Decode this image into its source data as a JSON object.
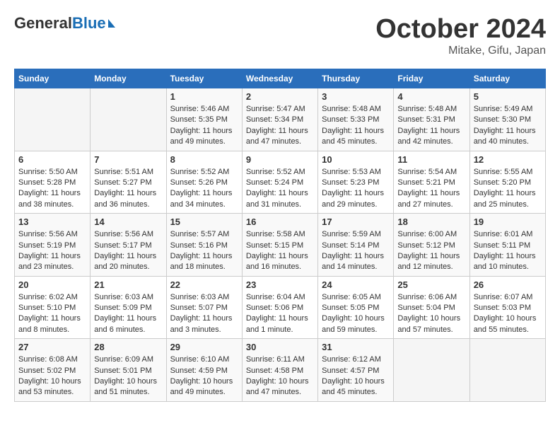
{
  "header": {
    "logo_general": "General",
    "logo_blue": "Blue",
    "month_title": "October 2024",
    "location": "Mitake, Gifu, Japan"
  },
  "days_of_week": [
    "Sunday",
    "Monday",
    "Tuesday",
    "Wednesday",
    "Thursday",
    "Friday",
    "Saturday"
  ],
  "weeks": [
    [
      {
        "day": "",
        "info": ""
      },
      {
        "day": "",
        "info": ""
      },
      {
        "day": "1",
        "info": "Sunrise: 5:46 AM\nSunset: 5:35 PM\nDaylight: 11 hours and 49 minutes."
      },
      {
        "day": "2",
        "info": "Sunrise: 5:47 AM\nSunset: 5:34 PM\nDaylight: 11 hours and 47 minutes."
      },
      {
        "day": "3",
        "info": "Sunrise: 5:48 AM\nSunset: 5:33 PM\nDaylight: 11 hours and 45 minutes."
      },
      {
        "day": "4",
        "info": "Sunrise: 5:48 AM\nSunset: 5:31 PM\nDaylight: 11 hours and 42 minutes."
      },
      {
        "day": "5",
        "info": "Sunrise: 5:49 AM\nSunset: 5:30 PM\nDaylight: 11 hours and 40 minutes."
      }
    ],
    [
      {
        "day": "6",
        "info": "Sunrise: 5:50 AM\nSunset: 5:28 PM\nDaylight: 11 hours and 38 minutes."
      },
      {
        "day": "7",
        "info": "Sunrise: 5:51 AM\nSunset: 5:27 PM\nDaylight: 11 hours and 36 minutes."
      },
      {
        "day": "8",
        "info": "Sunrise: 5:52 AM\nSunset: 5:26 PM\nDaylight: 11 hours and 34 minutes."
      },
      {
        "day": "9",
        "info": "Sunrise: 5:52 AM\nSunset: 5:24 PM\nDaylight: 11 hours and 31 minutes."
      },
      {
        "day": "10",
        "info": "Sunrise: 5:53 AM\nSunset: 5:23 PM\nDaylight: 11 hours and 29 minutes."
      },
      {
        "day": "11",
        "info": "Sunrise: 5:54 AM\nSunset: 5:21 PM\nDaylight: 11 hours and 27 minutes."
      },
      {
        "day": "12",
        "info": "Sunrise: 5:55 AM\nSunset: 5:20 PM\nDaylight: 11 hours and 25 minutes."
      }
    ],
    [
      {
        "day": "13",
        "info": "Sunrise: 5:56 AM\nSunset: 5:19 PM\nDaylight: 11 hours and 23 minutes."
      },
      {
        "day": "14",
        "info": "Sunrise: 5:56 AM\nSunset: 5:17 PM\nDaylight: 11 hours and 20 minutes."
      },
      {
        "day": "15",
        "info": "Sunrise: 5:57 AM\nSunset: 5:16 PM\nDaylight: 11 hours and 18 minutes."
      },
      {
        "day": "16",
        "info": "Sunrise: 5:58 AM\nSunset: 5:15 PM\nDaylight: 11 hours and 16 minutes."
      },
      {
        "day": "17",
        "info": "Sunrise: 5:59 AM\nSunset: 5:14 PM\nDaylight: 11 hours and 14 minutes."
      },
      {
        "day": "18",
        "info": "Sunrise: 6:00 AM\nSunset: 5:12 PM\nDaylight: 11 hours and 12 minutes."
      },
      {
        "day": "19",
        "info": "Sunrise: 6:01 AM\nSunset: 5:11 PM\nDaylight: 11 hours and 10 minutes."
      }
    ],
    [
      {
        "day": "20",
        "info": "Sunrise: 6:02 AM\nSunset: 5:10 PM\nDaylight: 11 hours and 8 minutes."
      },
      {
        "day": "21",
        "info": "Sunrise: 6:03 AM\nSunset: 5:09 PM\nDaylight: 11 hours and 6 minutes."
      },
      {
        "day": "22",
        "info": "Sunrise: 6:03 AM\nSunset: 5:07 PM\nDaylight: 11 hours and 3 minutes."
      },
      {
        "day": "23",
        "info": "Sunrise: 6:04 AM\nSunset: 5:06 PM\nDaylight: 11 hours and 1 minute."
      },
      {
        "day": "24",
        "info": "Sunrise: 6:05 AM\nSunset: 5:05 PM\nDaylight: 10 hours and 59 minutes."
      },
      {
        "day": "25",
        "info": "Sunrise: 6:06 AM\nSunset: 5:04 PM\nDaylight: 10 hours and 57 minutes."
      },
      {
        "day": "26",
        "info": "Sunrise: 6:07 AM\nSunset: 5:03 PM\nDaylight: 10 hours and 55 minutes."
      }
    ],
    [
      {
        "day": "27",
        "info": "Sunrise: 6:08 AM\nSunset: 5:02 PM\nDaylight: 10 hours and 53 minutes."
      },
      {
        "day": "28",
        "info": "Sunrise: 6:09 AM\nSunset: 5:01 PM\nDaylight: 10 hours and 51 minutes."
      },
      {
        "day": "29",
        "info": "Sunrise: 6:10 AM\nSunset: 4:59 PM\nDaylight: 10 hours and 49 minutes."
      },
      {
        "day": "30",
        "info": "Sunrise: 6:11 AM\nSunset: 4:58 PM\nDaylight: 10 hours and 47 minutes."
      },
      {
        "day": "31",
        "info": "Sunrise: 6:12 AM\nSunset: 4:57 PM\nDaylight: 10 hours and 45 minutes."
      },
      {
        "day": "",
        "info": ""
      },
      {
        "day": "",
        "info": ""
      }
    ]
  ]
}
